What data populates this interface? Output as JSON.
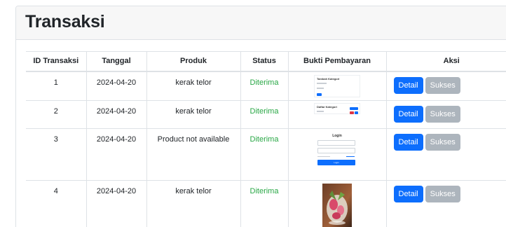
{
  "page": {
    "title": "Transaksi"
  },
  "table": {
    "headers": [
      "ID Transaksi",
      "Tanggal",
      "Produk",
      "Status",
      "Bukti Pembayaran",
      "Aksi"
    ],
    "rows": [
      {
        "id": "1",
        "tanggal": "2024-04-20",
        "produk": "kerak telor",
        "status": "Diterima",
        "detail": "Detail",
        "sukses": "Sukses"
      },
      {
        "id": "2",
        "tanggal": "2024-04-20",
        "produk": "kerak telor",
        "status": "Diterima",
        "detail": "Detail",
        "sukses": "Sukses"
      },
      {
        "id": "3",
        "tanggal": "2024-04-20",
        "produk": "Product not available",
        "status": "Diterima",
        "detail": "Detail",
        "sukses": "Sukses"
      },
      {
        "id": "4",
        "tanggal": "2024-04-20",
        "produk": "kerak telor",
        "status": "Diterima",
        "detail": "Detail",
        "sukses": "Sukses"
      }
    ]
  },
  "proof_thumbnails": [
    {
      "caption": "Tambah Kategori",
      "kind": "form-screenshot"
    },
    {
      "caption": "Daftar Kategori",
      "kind": "list-screenshot"
    },
    {
      "caption": "Login",
      "kind": "login-screenshot",
      "submit": "Login"
    },
    {
      "kind": "food-photo"
    }
  ],
  "colors": {
    "status": "#28a745",
    "detail_button": "#0d6efd",
    "sukses_button": "#adb5bd"
  }
}
